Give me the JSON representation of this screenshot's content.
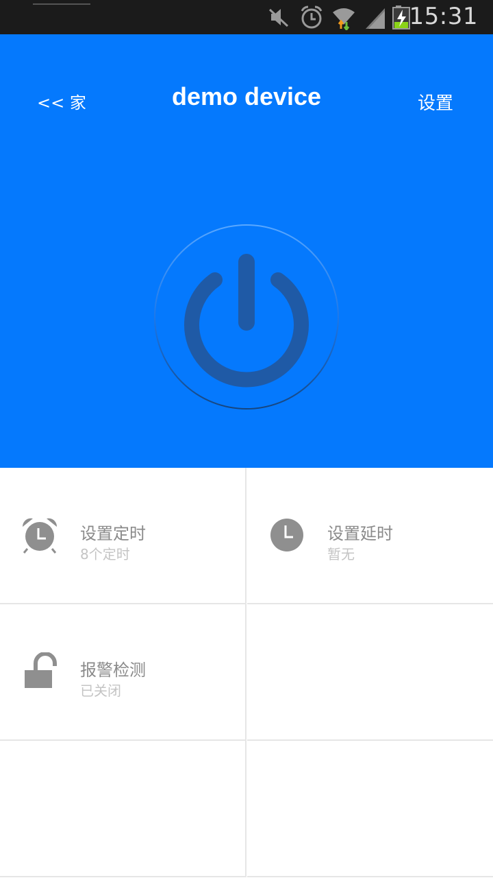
{
  "status_bar": {
    "time": "15:31",
    "icons": [
      "mute-icon",
      "alarm-icon",
      "wifi-icon",
      "signal-icon",
      "battery-charging-icon"
    ]
  },
  "header": {
    "back_label": "<< 家",
    "title": "demo device",
    "settings_label": "设置"
  },
  "power": {
    "icon": "power-icon"
  },
  "grid": {
    "items": [
      {
        "icon": "alarm-clock-icon",
        "label": "设置定时",
        "sub": "8个定时"
      },
      {
        "icon": "clock-icon",
        "label": "设置延时",
        "sub": "暂无"
      },
      {
        "icon": "unlock-icon",
        "label": "报警检测",
        "sub": "已关闭"
      }
    ]
  },
  "colors": {
    "accent": "#0579fd",
    "power_icon": "#1f5aa6",
    "icon_gray": "#8f8f8f",
    "label_gray": "#8a8a8a",
    "sub_gray": "#c4c4c4"
  }
}
